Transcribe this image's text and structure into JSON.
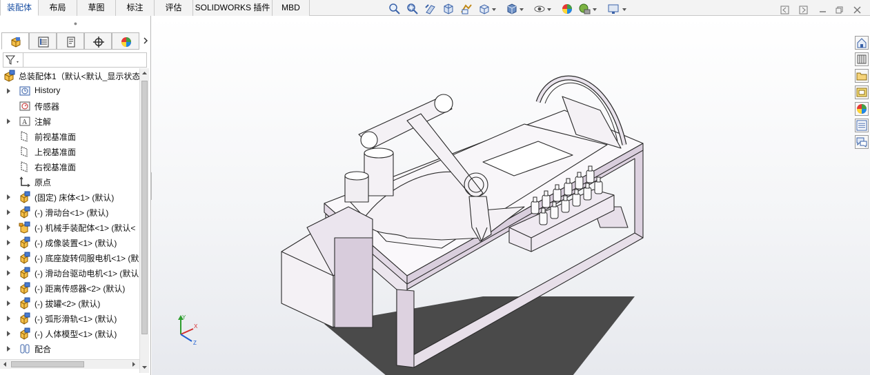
{
  "tabs": [
    {
      "label": "装配体",
      "active": true
    },
    {
      "label": "布局",
      "active": false
    },
    {
      "label": "草图",
      "active": false
    },
    {
      "label": "标注",
      "active": false
    },
    {
      "label": "评估",
      "active": false
    },
    {
      "label": "SOLIDWORKS 插件",
      "active": false
    },
    {
      "label": "MBD",
      "active": false
    }
  ],
  "view_toolbar_icons": [
    "zoom-to-fit-icon",
    "zoom-to-area-icon",
    "previous-view-icon",
    "section-view-icon",
    "dynamic-annotation-icon",
    "view-orientation-icon",
    "display-style-icon",
    "hide-show-icon",
    "edit-appearance-icon",
    "apply-scene-icon",
    "view-settings-icon"
  ],
  "panel_tabs": [
    "feature-manager-icon",
    "property-manager-icon",
    "configuration-manager-icon",
    "dimxpert-manager-icon",
    "display-manager-icon"
  ],
  "tree": {
    "root_label": "总装配体1（默认<默认_显示状态",
    "items": [
      {
        "label": "History",
        "icon": "history-icon",
        "expandable": true
      },
      {
        "label": "传感器",
        "icon": "sensor-icon",
        "expandable": false
      },
      {
        "label": "注解",
        "icon": "annotation-icon",
        "expandable": true
      },
      {
        "label": "前视基准面",
        "icon": "plane-icon",
        "expandable": false
      },
      {
        "label": "上视基准面",
        "icon": "plane-icon",
        "expandable": false
      },
      {
        "label": "右视基准面",
        "icon": "plane-icon",
        "expandable": false
      },
      {
        "label": "原点",
        "icon": "origin-icon",
        "expandable": false
      },
      {
        "label": "(固定) 床体<1> (默认)",
        "icon": "part-icon",
        "expandable": true
      },
      {
        "label": "(-) 滑动台<1> (默认)",
        "icon": "part-icon",
        "expandable": true
      },
      {
        "label": "(-) 机械手装配体<1> (默认<",
        "icon": "subassembly-icon",
        "expandable": true
      },
      {
        "label": "(-) 成像装置<1> (默认)",
        "icon": "part-icon",
        "expandable": true
      },
      {
        "label": "(-) 底座旋转伺服电机<1> (默",
        "icon": "part-icon",
        "expandable": true
      },
      {
        "label": "(-) 滑动台驱动电机<1> (默认",
        "icon": "part-icon",
        "expandable": true
      },
      {
        "label": "(-) 距离传感器<2> (默认)",
        "icon": "part-icon",
        "expandable": true
      },
      {
        "label": "(-) 拔罐<2> (默认)",
        "icon": "part-icon",
        "expandable": true
      },
      {
        "label": "(-) 弧形滑轨<1> (默认)",
        "icon": "part-icon",
        "expandable": true
      },
      {
        "label": "(-) 人体模型<1> (默认)",
        "icon": "part-icon",
        "expandable": true
      },
      {
        "label": "配合",
        "icon": "mates-icon",
        "expandable": true
      }
    ]
  },
  "triad": {
    "x": "X",
    "y": "Y",
    "z": "Z"
  },
  "task_pane_icons": [
    "home-icon",
    "design-library-icon",
    "file-explorer-icon",
    "view-palette-icon",
    "appearances-icon",
    "custom-properties-icon",
    "forum-icon"
  ],
  "colors": {
    "accent": "#1a4fa3",
    "model_face": "#f2eef3",
    "model_edge": "#2a2a2a",
    "shadow": "#4a4a4a"
  }
}
